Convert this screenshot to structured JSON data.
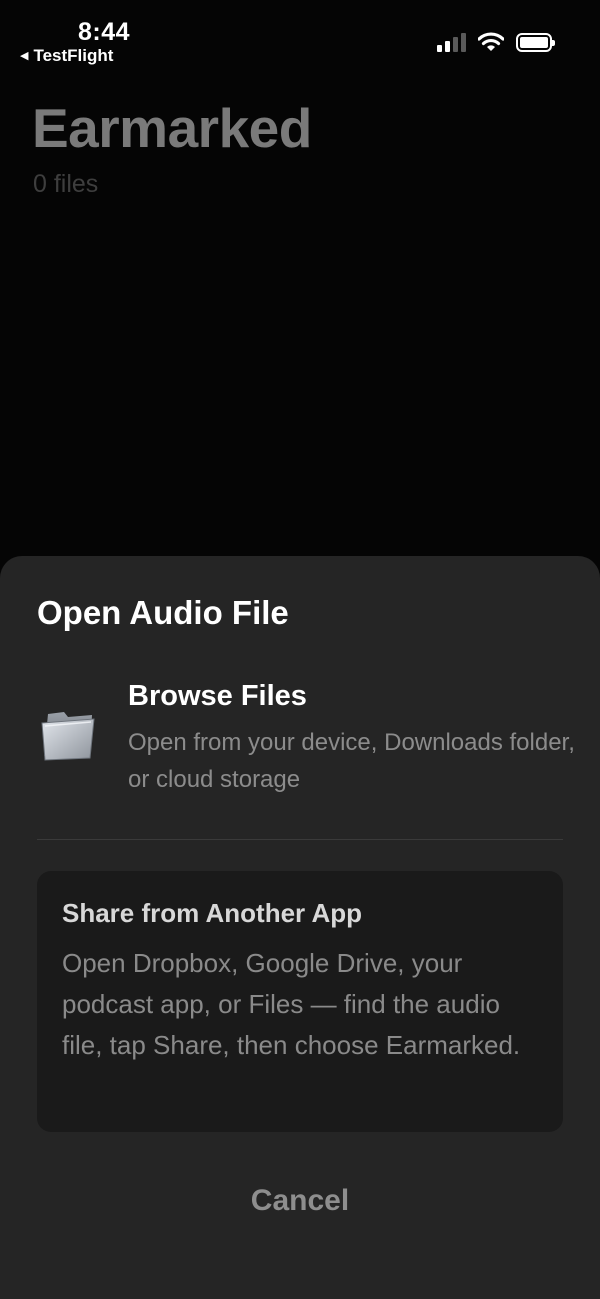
{
  "status_bar": {
    "time": "8:44",
    "back_label": "TestFlight",
    "back_icon": "back-caret-icon",
    "icons": [
      "cellular-signal-icon",
      "wifi-icon",
      "battery-icon"
    ]
  },
  "page": {
    "title": "Earmarked",
    "subtitle": "0 files"
  },
  "sheet": {
    "title": "Open Audio File",
    "browse": {
      "icon": "folder-icon",
      "title": "Browse Files",
      "description": "Open from your device, Downloads folder, or cloud storage"
    },
    "share": {
      "title": "Share from Another App",
      "description": "Open Dropbox, Google Drive, your podcast app, or Files — find the audio file, tap Share, then choose Earmarked."
    },
    "cancel_label": "Cancel"
  },
  "colors": {
    "background": "#050505",
    "sheet": "#252525",
    "card": "#1a1a1a",
    "secondary_text": "#8c8c8c"
  }
}
